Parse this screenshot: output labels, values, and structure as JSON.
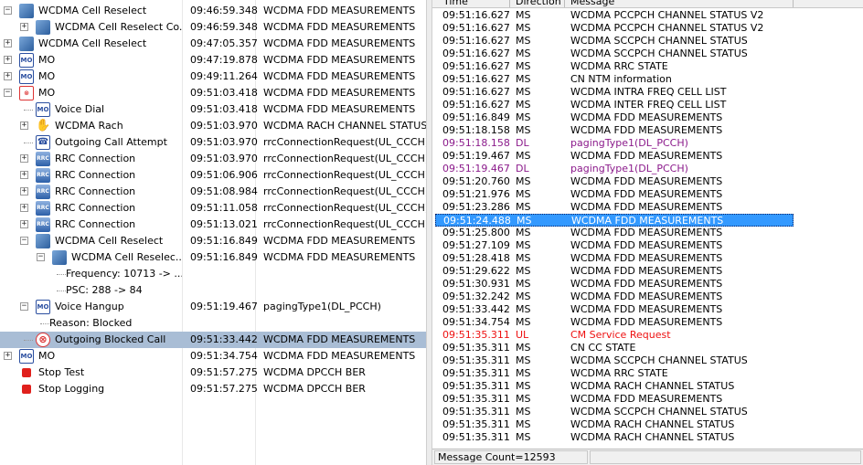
{
  "tree": [
    {
      "indent": 0,
      "exp": "minus",
      "icon": "cell",
      "icon_name": "cell-reselect-icon",
      "label": "WCDMA Cell Reselect",
      "time": "09:46:59.348",
      "message": "WCDMA FDD MEASUREMENTS"
    },
    {
      "indent": 1,
      "exp": "plus",
      "icon": "cell",
      "icon_name": "cell-reselect-icon",
      "label": "WCDMA Cell Reselect Co...",
      "time": "09:46:59.348",
      "message": "WCDMA FDD MEASUREMENTS"
    },
    {
      "indent": 0,
      "exp": "plus",
      "icon": "cell",
      "icon_name": "cell-reselect-icon",
      "label": "WCDMA Cell Reselect",
      "time": "09:47:05.357",
      "message": "WCDMA FDD MEASUREMENTS"
    },
    {
      "indent": 0,
      "exp": "plus",
      "icon": "mo",
      "icon_name": "mo-call-icon",
      "label": "MO",
      "time": "09:47:19.878",
      "message": "WCDMA FDD MEASUREMENTS"
    },
    {
      "indent": 0,
      "exp": "plus",
      "icon": "mo",
      "icon_name": "mo-call-icon",
      "label": "MO",
      "time": "09:49:11.264",
      "message": "WCDMA FDD MEASUREMENTS"
    },
    {
      "indent": 0,
      "exp": "minus",
      "icon": "mo-x",
      "icon_name": "mo-call-failed-icon",
      "label": "MO",
      "time": "09:51:03.418",
      "message": "WCDMA FDD MEASUREMENTS"
    },
    {
      "indent": 1,
      "exp": "none",
      "icon": "voice",
      "icon_name": "voice-dial-icon",
      "label": "Voice Dial",
      "time": "09:51:03.418",
      "message": "WCDMA FDD MEASUREMENTS"
    },
    {
      "indent": 1,
      "exp": "plus",
      "icon": "rach",
      "icon_name": "rach-hand-icon",
      "label": "WCDMA Rach",
      "time": "09:51:03.970",
      "message": "WCDMA RACH CHANNEL STATUS"
    },
    {
      "indent": 1,
      "exp": "none",
      "icon": "call",
      "icon_name": "phone-call-icon",
      "label": "Outgoing Call Attempt",
      "time": "09:51:03.970",
      "message": "rrcConnectionRequest(UL_CCCH)"
    },
    {
      "indent": 1,
      "exp": "plus",
      "icon": "rrc",
      "icon_name": "rrc-connection-icon",
      "label": "RRC Connection",
      "time": "09:51:03.970",
      "message": "rrcConnectionRequest(UL_CCCH)"
    },
    {
      "indent": 1,
      "exp": "plus",
      "icon": "rrc",
      "icon_name": "rrc-connection-icon",
      "label": "RRC Connection",
      "time": "09:51:06.906",
      "message": "rrcConnectionRequest(UL_CCCH)"
    },
    {
      "indent": 1,
      "exp": "plus",
      "icon": "rrc",
      "icon_name": "rrc-connection-icon",
      "label": "RRC Connection",
      "time": "09:51:08.984",
      "message": "rrcConnectionRequest(UL_CCCH)"
    },
    {
      "indent": 1,
      "exp": "plus",
      "icon": "rrc",
      "icon_name": "rrc-connection-icon",
      "label": "RRC Connection",
      "time": "09:51:11.058",
      "message": "rrcConnectionRequest(UL_CCCH)"
    },
    {
      "indent": 1,
      "exp": "plus",
      "icon": "rrc",
      "icon_name": "rrc-connection-icon",
      "label": "RRC Connection",
      "time": "09:51:13.021",
      "message": "rrcConnectionRequest(UL_CCCH)"
    },
    {
      "indent": 1,
      "exp": "minus",
      "icon": "cell",
      "icon_name": "cell-reselect-icon",
      "label": "WCDMA Cell Reselect",
      "time": "09:51:16.849",
      "message": "WCDMA FDD MEASUREMENTS"
    },
    {
      "indent": 2,
      "exp": "minus",
      "icon": "cell",
      "icon_name": "cell-reselect-icon",
      "label": "WCDMA Cell Reselec...",
      "time": "09:51:16.849",
      "message": "WCDMA FDD MEASUREMENTS"
    },
    {
      "indent": 3,
      "exp": "none",
      "icon": "",
      "icon_name": "",
      "label": "Frequency: 10713 -> ...",
      "time": "",
      "message": ""
    },
    {
      "indent": 3,
      "exp": "none",
      "icon": "",
      "icon_name": "",
      "label": "PSC: 288 -> 84",
      "time": "",
      "message": ""
    },
    {
      "indent": 1,
      "exp": "minus",
      "icon": "hang",
      "icon_name": "voice-hangup-icon",
      "label": "Voice Hangup",
      "time": "09:51:19.467",
      "message": "pagingType1(DL_PCCH)"
    },
    {
      "indent": 2,
      "exp": "none",
      "icon": "",
      "icon_name": "",
      "label": "Reason: Blocked",
      "time": "",
      "message": ""
    },
    {
      "indent": 1,
      "exp": "none",
      "icon": "block",
      "icon_name": "blocked-call-icon",
      "label": "Outgoing Blocked Call",
      "time": "09:51:33.442",
      "message": "WCDMA FDD MEASUREMENTS",
      "selected": true
    },
    {
      "indent": 0,
      "exp": "plus",
      "icon": "mo",
      "icon_name": "mo-call-icon",
      "label": "MO",
      "time": "09:51:34.754",
      "message": "WCDMA FDD MEASUREMENTS"
    },
    {
      "indent": 0,
      "exp": "none",
      "icon": "stop",
      "icon_name": "stop-test-icon",
      "label": "Stop Test",
      "time": "09:51:57.275",
      "message": "WCDMA DPCCH BER"
    },
    {
      "indent": 0,
      "exp": "none",
      "icon": "stop",
      "icon_name": "stop-logging-icon",
      "label": "Stop Logging",
      "time": "09:51:57.275",
      "message": "WCDMA DPCCH BER"
    }
  ],
  "message_headers": {
    "time": "Time",
    "direction": "Direction",
    "message": "Message"
  },
  "messages": [
    {
      "time": "09:51:16.627",
      "dir": "MS",
      "msg": "WCDMA PCCPCH CHANNEL STATUS V2"
    },
    {
      "time": "09:51:16.627",
      "dir": "MS",
      "msg": "WCDMA PCCPCH CHANNEL STATUS V2"
    },
    {
      "time": "09:51:16.627",
      "dir": "MS",
      "msg": "WCDMA SCCPCH CHANNEL STATUS"
    },
    {
      "time": "09:51:16.627",
      "dir": "MS",
      "msg": "WCDMA SCCPCH CHANNEL STATUS"
    },
    {
      "time": "09:51:16.627",
      "dir": "MS",
      "msg": "WCDMA RRC STATE"
    },
    {
      "time": "09:51:16.627",
      "dir": "MS",
      "msg": "CN NTM information"
    },
    {
      "time": "09:51:16.627",
      "dir": "MS",
      "msg": "WCDMA INTRA FREQ CELL LIST"
    },
    {
      "time": "09:51:16.627",
      "dir": "MS",
      "msg": "WCDMA INTER FREQ CELL LIST"
    },
    {
      "time": "09:51:16.849",
      "dir": "MS",
      "msg": "WCDMA FDD MEASUREMENTS"
    },
    {
      "time": "09:51:18.158",
      "dir": "MS",
      "msg": "WCDMA FDD MEASUREMENTS"
    },
    {
      "time": "09:51:18.158",
      "dir": "DL",
      "msg": "pagingType1(DL_PCCH)",
      "color": "purple"
    },
    {
      "time": "09:51:19.467",
      "dir": "MS",
      "msg": "WCDMA FDD MEASUREMENTS"
    },
    {
      "time": "09:51:19.467",
      "dir": "DL",
      "msg": "pagingType1(DL_PCCH)",
      "color": "purple"
    },
    {
      "time": "09:51:20.760",
      "dir": "MS",
      "msg": "WCDMA FDD MEASUREMENTS"
    },
    {
      "time": "09:51:21.976",
      "dir": "MS",
      "msg": "WCDMA FDD MEASUREMENTS"
    },
    {
      "time": "09:51:23.286",
      "dir": "MS",
      "msg": "WCDMA FDD MEASUREMENTS"
    },
    {
      "time": "09:51:24.488",
      "dir": "MS",
      "msg": "WCDMA FDD MEASUREMENTS",
      "selected": true
    },
    {
      "time": "09:51:25.800",
      "dir": "MS",
      "msg": "WCDMA FDD MEASUREMENTS"
    },
    {
      "time": "09:51:27.109",
      "dir": "MS",
      "msg": "WCDMA FDD MEASUREMENTS"
    },
    {
      "time": "09:51:28.418",
      "dir": "MS",
      "msg": "WCDMA FDD MEASUREMENTS"
    },
    {
      "time": "09:51:29.622",
      "dir": "MS",
      "msg": "WCDMA FDD MEASUREMENTS"
    },
    {
      "time": "09:51:30.931",
      "dir": "MS",
      "msg": "WCDMA FDD MEASUREMENTS"
    },
    {
      "time": "09:51:32.242",
      "dir": "MS",
      "msg": "WCDMA FDD MEASUREMENTS"
    },
    {
      "time": "09:51:33.442",
      "dir": "MS",
      "msg": "WCDMA FDD MEASUREMENTS"
    },
    {
      "time": "09:51:34.754",
      "dir": "MS",
      "msg": "WCDMA FDD MEASUREMENTS"
    },
    {
      "time": "09:51:35.311",
      "dir": "UL",
      "msg": "CM Service Request",
      "color": "red"
    },
    {
      "time": "09:51:35.311",
      "dir": "MS",
      "msg": "CN CC STATE"
    },
    {
      "time": "09:51:35.311",
      "dir": "MS",
      "msg": "WCDMA SCCPCH CHANNEL STATUS"
    },
    {
      "time": "09:51:35.311",
      "dir": "MS",
      "msg": "WCDMA RRC STATE"
    },
    {
      "time": "09:51:35.311",
      "dir": "MS",
      "msg": "WCDMA RACH CHANNEL STATUS"
    },
    {
      "time": "09:51:35.311",
      "dir": "MS",
      "msg": "WCDMA FDD MEASUREMENTS"
    },
    {
      "time": "09:51:35.311",
      "dir": "MS",
      "msg": "WCDMA SCCPCH CHANNEL STATUS"
    },
    {
      "time": "09:51:35.311",
      "dir": "MS",
      "msg": "WCDMA RACH CHANNEL STATUS"
    },
    {
      "time": "09:51:35.311",
      "dir": "MS",
      "msg": "WCDMA RACH CHANNEL STATUS"
    }
  ],
  "status": {
    "message_count": "Message Count=12593"
  },
  "icon_text": {
    "mo": "MO",
    "voice": "MO",
    "rrc": "RRC",
    "hang": "MO",
    "call": "☎",
    "rach": "✋",
    "block": "⊗",
    "mo-x": "⊗"
  }
}
